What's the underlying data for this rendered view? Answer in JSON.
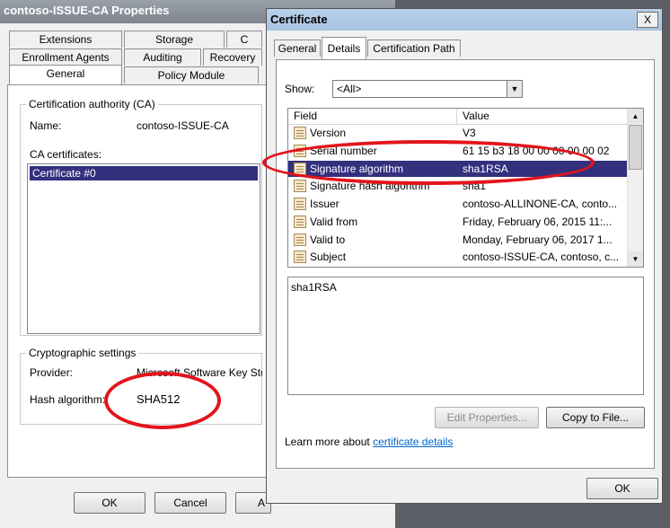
{
  "back_dialog": {
    "title": "contoso-ISSUE-CA Properties",
    "tabs_row1": [
      "Extensions",
      "Storage",
      "C"
    ],
    "tabs_row2": [
      "Enrollment Agents",
      "Auditing",
      "Recovery"
    ],
    "tabs_row3": [
      "General",
      "Policy Module"
    ],
    "ca_group_label": "Certification authority (CA)",
    "name_label": "Name:",
    "name_value": "contoso-ISSUE-CA",
    "ca_certs_label": "CA certificates:",
    "ca_cert_item": "Certificate #0",
    "crypto_group_label": "Cryptographic settings",
    "provider_label": "Provider:",
    "provider_value": "Microsoft Software Key Sto",
    "hash_label": "Hash algorithm:",
    "hash_value": "SHA512",
    "ok_button": "OK",
    "cancel_button": "Cancel",
    "apply_button": "A"
  },
  "front_dialog": {
    "title": "Certificate",
    "close_glyph": "X",
    "tabs": [
      "General",
      "Details",
      "Certification Path"
    ],
    "show_label": "Show:",
    "show_value": "<All>",
    "columns": [
      "Field",
      "Value"
    ],
    "rows": [
      {
        "field": "Version",
        "value": "V3"
      },
      {
        "field": "Serial number",
        "value": "61 15 b3 18 00 00 00 00 00 02"
      },
      {
        "field": "Signature algorithm",
        "value": "sha1RSA"
      },
      {
        "field": "Signature hash algorithm",
        "value": "sha1"
      },
      {
        "field": "Issuer",
        "value": "contoso-ALLINONE-CA, conto..."
      },
      {
        "field": "Valid from",
        "value": "Friday, February 06, 2015 11:..."
      },
      {
        "field": "Valid to",
        "value": "Monday, February 06, 2017 1..."
      },
      {
        "field": "Subject",
        "value": "contoso-ISSUE-CA, contoso, c..."
      }
    ],
    "selected_row": 2,
    "value_text": "sha1RSA",
    "edit_properties_button": "Edit Properties...",
    "copy_to_file_button": "Copy to File...",
    "learn_more_prefix": "Learn more about ",
    "learn_more_link": "certificate details",
    "ok_button": "OK"
  },
  "colors": {
    "selection": "#33307e",
    "annotation": "#e3141b",
    "link": "#0066cc"
  }
}
